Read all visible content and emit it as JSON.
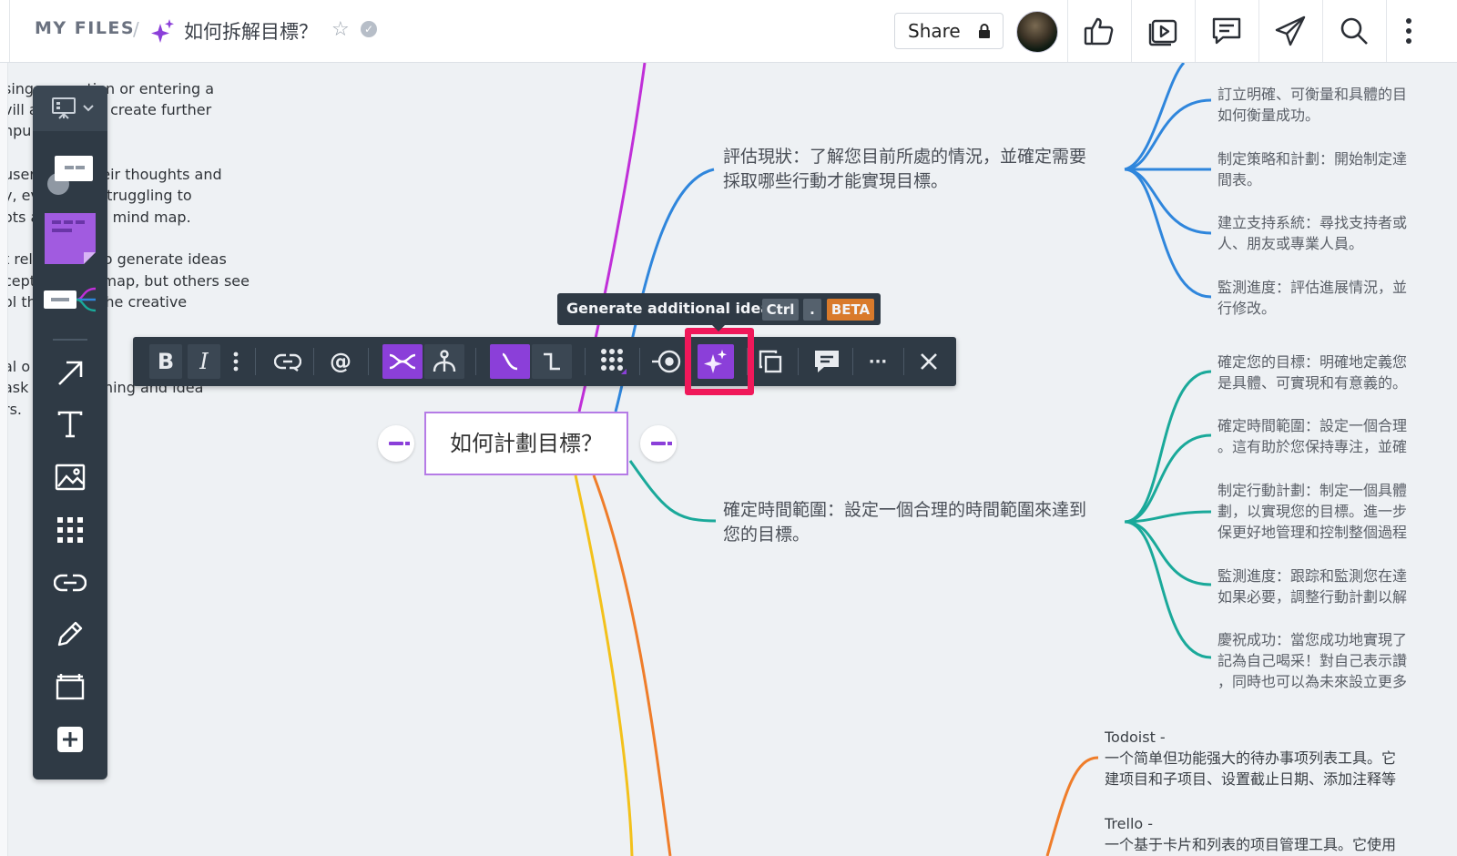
{
  "header": {
    "breadcrumb_root": "MY FILES",
    "breadcrumb_separator": "/",
    "document_title": "如何拆解目標？",
    "share_label": "Share",
    "icons": [
      "sparkle-icon",
      "star-icon",
      "verified-check-icon",
      "lock-icon",
      "thumbs-up-icon",
      "presentation-play-icon",
      "comment-icon",
      "send-icon",
      "search-icon",
      "more-vertical-icon"
    ]
  },
  "background_text": [
    "sing a question or entering a",
    "vill a           lly create further",
    "npu",
    "",
    "user           their thoughts and",
    "y, ev          e struggling to",
    "ots a          nal mind map.",
    "",
    "t rel          AI to generate ideas",
    "cept            \" map, but others see",
    "ol th           s the creative",
    "",
    "",
    "al o           nim",
    "ask            orming and idea",
    "rs."
  ],
  "mindmap": {
    "center_node": "如何計劃目標？",
    "branch_assess": [
      "評估現狀：了解您目前所處的情況，並確定需要",
      "採取哪些行動才能實現目標。"
    ],
    "branch_timeframe": [
      "確定時間範圍：設定一個合理的時間範圍來達到",
      "您的目標。"
    ],
    "assess_leaves": [
      [
        "訂立明確、可衡量和具體的目",
        "如何衡量成功。"
      ],
      [
        "制定策略和計劃：開始制定達",
        "間表。"
      ],
      [
        "建立支持系統：尋找支持者或",
        "人、朋友或專業人員。"
      ],
      [
        "監測進度：評估進展情況，並",
        "行修改。"
      ]
    ],
    "timeframe_leaves": [
      [
        "確定您的目標：明確地定義您",
        "是具體、可實現和有意義的。"
      ],
      [
        "確定時間範圍：設定一個合理",
        "。這有助於您保持專注，並確"
      ],
      [
        "制定行動計劃：制定一個具體",
        "劃，以實現您的目標。進一步",
        "保更好地管理和控制整個過程"
      ],
      [
        "監測進度：跟踪和監測您在達",
        "如果必要，調整行動計劃以解"
      ],
      [
        "慶祝成功：當您成功地實現了",
        "記為自己喝采！對自己表示讚",
        "，同時也可以為未來設立更多"
      ]
    ],
    "tools": [
      [
        "Todoist -",
        "一个简单但功能强大的待办事项列表工具。它",
        "建项目和子项目、设置截止日期、添加注释等"
      ],
      [
        "Trello -",
        "一个基于卡片和列表的项目管理工具。它使用"
      ]
    ]
  },
  "format_toolbar": {
    "bold_label": "B",
    "italic_label": "I",
    "mention_label": "@",
    "more_label": "···",
    "icons": [
      "vertical-dots-icon",
      "link-icon",
      "mindmap-branch-icon",
      "org-chart-icon",
      "curved-line-icon",
      "elbow-line-icon",
      "grid-color-icon",
      "focus-target-icon",
      "ai-sparkle-icon",
      "duplicate-icon",
      "comment-icon",
      "close-icon"
    ]
  },
  "tooltip": {
    "label": "Generate additional ideas",
    "key1": "Ctrl",
    "key2": ".",
    "badge": "BETA"
  },
  "left_toolbar": {
    "icons": [
      "presentation-icon",
      "chevron-down-icon",
      "shapes-icon",
      "sticky-note-icon",
      "mindmap-icon",
      "arrow-icon",
      "text-icon",
      "image-icon",
      "apps-grid-icon",
      "link-icon",
      "pen-icon",
      "frame-icon",
      "plus-icon"
    ]
  },
  "colors": {
    "accent_purple": "#8b3fd9",
    "highlight_red": "#f0185a",
    "blue_branch": "#2f86dc",
    "teal_branch": "#1aa99a",
    "magenta_branch": "#c02fd8",
    "yellow_branch": "#f3c11b",
    "orange_branch": "#ef7d2a",
    "beta_badge": "#d97a2b",
    "toolbar_bg": "#2f3a45"
  }
}
